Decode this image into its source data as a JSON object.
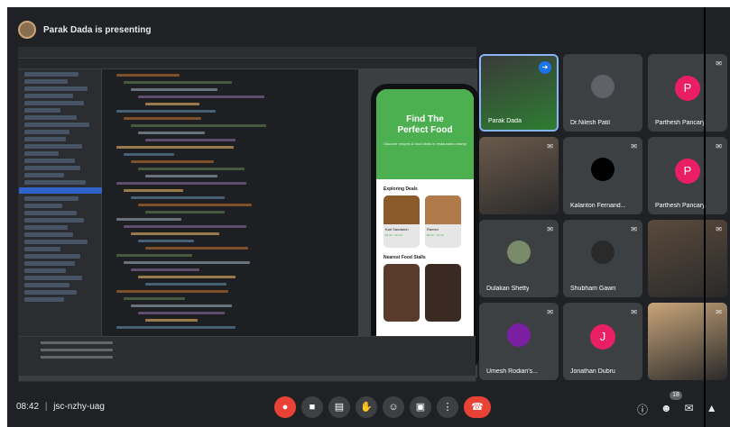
{
  "meeting": {
    "presenting_text": "Parak Dada is presenting",
    "time": "08:42",
    "separator": "|",
    "code": "jsc-nzhy-uag",
    "participant_count": "18"
  },
  "app": {
    "title_line1": "Find The",
    "title_line2": "Perfect Food",
    "subtitle": "Discover recipes & food deals in restaurants nearby",
    "section_1": "Exploring Deals",
    "section_2": "Nearest Food Stalls",
    "cards": [
      {
        "name": "Kari Sandwich",
        "meta": "$6.40 · 12 min"
      },
      {
        "name": "Ramen",
        "meta": "$8.20 · 18 min"
      }
    ]
  },
  "participants": [
    {
      "name": "Parak Dada",
      "letter": "",
      "color": "#2e7d32",
      "muted": false
    },
    {
      "name": "Dr.Nilesh Patil",
      "letter": "",
      "color": "#5f6368",
      "muted": false
    },
    {
      "name": "Parthesh Pancary",
      "letter": "P",
      "color": "#e91e63",
      "muted": true
    },
    {
      "name": "",
      "letter": "",
      "color": "#6b5a4c",
      "muted": true
    },
    {
      "name": "Kalanton Fernand...",
      "letter": "",
      "color": "#000000",
      "muted": true
    },
    {
      "name": "Parthesh Pancary",
      "letter": "P",
      "color": "#e91e63",
      "muted": true
    },
    {
      "name": "Dulakan Shetty",
      "letter": "",
      "color": "#7a8b6a",
      "muted": true
    },
    {
      "name": "Shubham Gawri",
      "letter": "",
      "color": "#2a2a2a",
      "muted": true
    },
    {
      "name": "",
      "letter": "",
      "color": "#5a4a3c",
      "muted": true
    },
    {
      "name": "Umesh Rodian's...",
      "letter": "",
      "color": "#7b1fa2",
      "muted": true
    },
    {
      "name": "Jonathan Dubru",
      "letter": "J",
      "color": "#e91e63",
      "muted": true
    },
    {
      "name": "",
      "letter": "",
      "color": "#c9a57a",
      "muted": true
    }
  ],
  "controls": [
    "mic",
    "camera",
    "captions",
    "hand",
    "emoji",
    "present",
    "more",
    "leave"
  ],
  "colors": {
    "accent_green": "#4caf50",
    "end_call": "#ea4335",
    "tile_bg": "#3c4043",
    "pin": "#1a73e8"
  }
}
